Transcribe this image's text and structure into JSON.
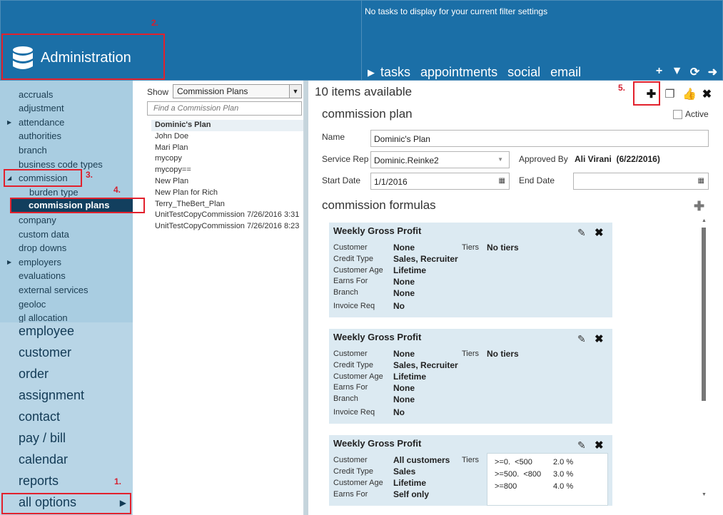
{
  "header": {
    "title": "Administration",
    "tasks_message": "No tasks to display for your current filter settings",
    "nav": [
      "tasks",
      "appointments",
      "social",
      "email"
    ],
    "tools": {
      "add": "+",
      "filter": "▼",
      "refresh": "⟳",
      "next": "➜"
    }
  },
  "sidebar": {
    "items": [
      "accruals",
      "adjustment",
      "attendance",
      "authorities",
      "branch",
      "business code types",
      "commission",
      "burden type",
      "commission plans",
      "company",
      "custom data",
      "drop downs",
      "employers",
      "evaluations",
      "external services",
      "geoloc",
      "gl allocation"
    ],
    "main": [
      "employee",
      "customer",
      "order",
      "assignment",
      "contact",
      "pay / bill",
      "calendar",
      "reports",
      "all options"
    ]
  },
  "list": {
    "show_label": "Show",
    "show_value": "Commission Plans",
    "search_placeholder": "Find a Commission Plan",
    "plans": [
      "Dominic's Plan",
      "John Doe",
      "Mari Plan",
      "mycopy",
      "mycopy==",
      "New Plan",
      "New Plan for Rich",
      "Terry_TheBert_Plan",
      "UnitTestCopyCommission 7/26/2016 3:31",
      "UnitTestCopyCommission 7/26/2016 8:23"
    ]
  },
  "detail": {
    "items_count": "10 items available",
    "plan_heading": "commission plan",
    "active_label": "Active",
    "name_label": "Name",
    "name_value": "Dominic's Plan",
    "service_rep_label": "Service Rep",
    "service_rep_value": "Dominic.Reinke2",
    "approved_by_label": "Approved By",
    "approved_by_value": "Ali Virani  (6/22/2016)",
    "start_date_label": "Start Date",
    "start_date_value": "1/1/2016",
    "end_date_label": "End Date",
    "end_date_value": "",
    "formulas_heading": "commission formulas",
    "tiers_label": "Tiers",
    "labels": {
      "customer": "Customer",
      "credit_type": "Credit Type",
      "customer_age": "Customer Age",
      "earns_for": "Earns For",
      "branch": "Branch",
      "invoice_req": "Invoice Req"
    },
    "formulas": [
      {
        "title": "Weekly Gross Profit",
        "customer": "None",
        "credit_type": "Sales, Recruiter",
        "customer_age": "Lifetime",
        "earns_for": "None",
        "branch": "None",
        "invoice_req": "No",
        "tiers": "No tiers"
      },
      {
        "title": "Weekly Gross Profit",
        "customer": "None",
        "credit_type": "Sales, Recruiter",
        "customer_age": "Lifetime",
        "earns_for": "None",
        "branch": "None",
        "invoice_req": "No",
        "tiers": "No tiers"
      },
      {
        "title": "Weekly Gross Profit",
        "customer": "All customers",
        "credit_type": "Sales",
        "customer_age": "Lifetime",
        "earns_for": "Self only",
        "tiers_rows": [
          {
            "range": ">=0.  <500",
            "pct": "2.0 %"
          },
          {
            "range": ">=500.  <800",
            "pct": "3.0 %"
          },
          {
            "range": ">=800",
            "pct": "4.0 %"
          }
        ]
      }
    ]
  },
  "annotations": [
    "1.",
    "2.",
    "3.",
    "4.",
    "5."
  ],
  "colors": {
    "header": "#1b6fa7",
    "sidebar": "#a9cde1",
    "selected": "#123f5e",
    "annotation": "#e2212d"
  }
}
